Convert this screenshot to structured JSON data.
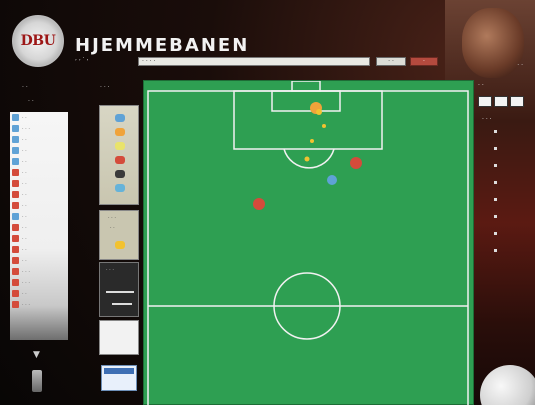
{
  "app": {
    "title": "HJEMMEBANEN",
    "logo_text": "DBU",
    "subline": "  ,   ,   ·  ,  "
  },
  "toolbar": {
    "field_value": "· ·  · ·",
    "button_1": "·  ·",
    "button_2": "  ·"
  },
  "top_right": {
    "text": "· ·"
  },
  "left_panel": {
    "heading_1": "·  ·",
    "heading_2": "· · ·",
    "heading_3": "· ·",
    "players": [
      {
        "team": "blue",
        "label": "·  ·"
      },
      {
        "team": "blue",
        "label": "· · ·"
      },
      {
        "team": "blue",
        "label": "·  ·"
      },
      {
        "team": "blue",
        "label": "· ·"
      },
      {
        "team": "blue",
        "label": "· ·"
      },
      {
        "team": "red",
        "label": "·  ·"
      },
      {
        "team": "red",
        "label": "· ·"
      },
      {
        "team": "red",
        "label": "·  ·"
      },
      {
        "team": "red",
        "label": "· ·"
      },
      {
        "team": "blue",
        "label": "· ·"
      },
      {
        "team": "red",
        "label": "· ·"
      },
      {
        "team": "red",
        "label": "·  ·"
      },
      {
        "team": "red",
        "label": "· ·"
      },
      {
        "team": "red",
        "label": "· ·"
      },
      {
        "team": "red",
        "label": "· · ·"
      },
      {
        "team": "red",
        "label": "·  · ·"
      },
      {
        "team": "red",
        "label": "· ·"
      },
      {
        "team": "red",
        "label": "·  · ·"
      }
    ]
  },
  "tools": {
    "panel2_label_1": "· · ·",
    "panel2_label_2": "· ·",
    "panel3_label": "· · ·"
  },
  "right_panel": {
    "heading": "· ·",
    "label": "· · ·"
  },
  "colors": {
    "pitch": "#2e9f52",
    "blue_team": "#5fa2d6",
    "red_team": "#d44b3b",
    "ball_marker": "#f2c230"
  }
}
